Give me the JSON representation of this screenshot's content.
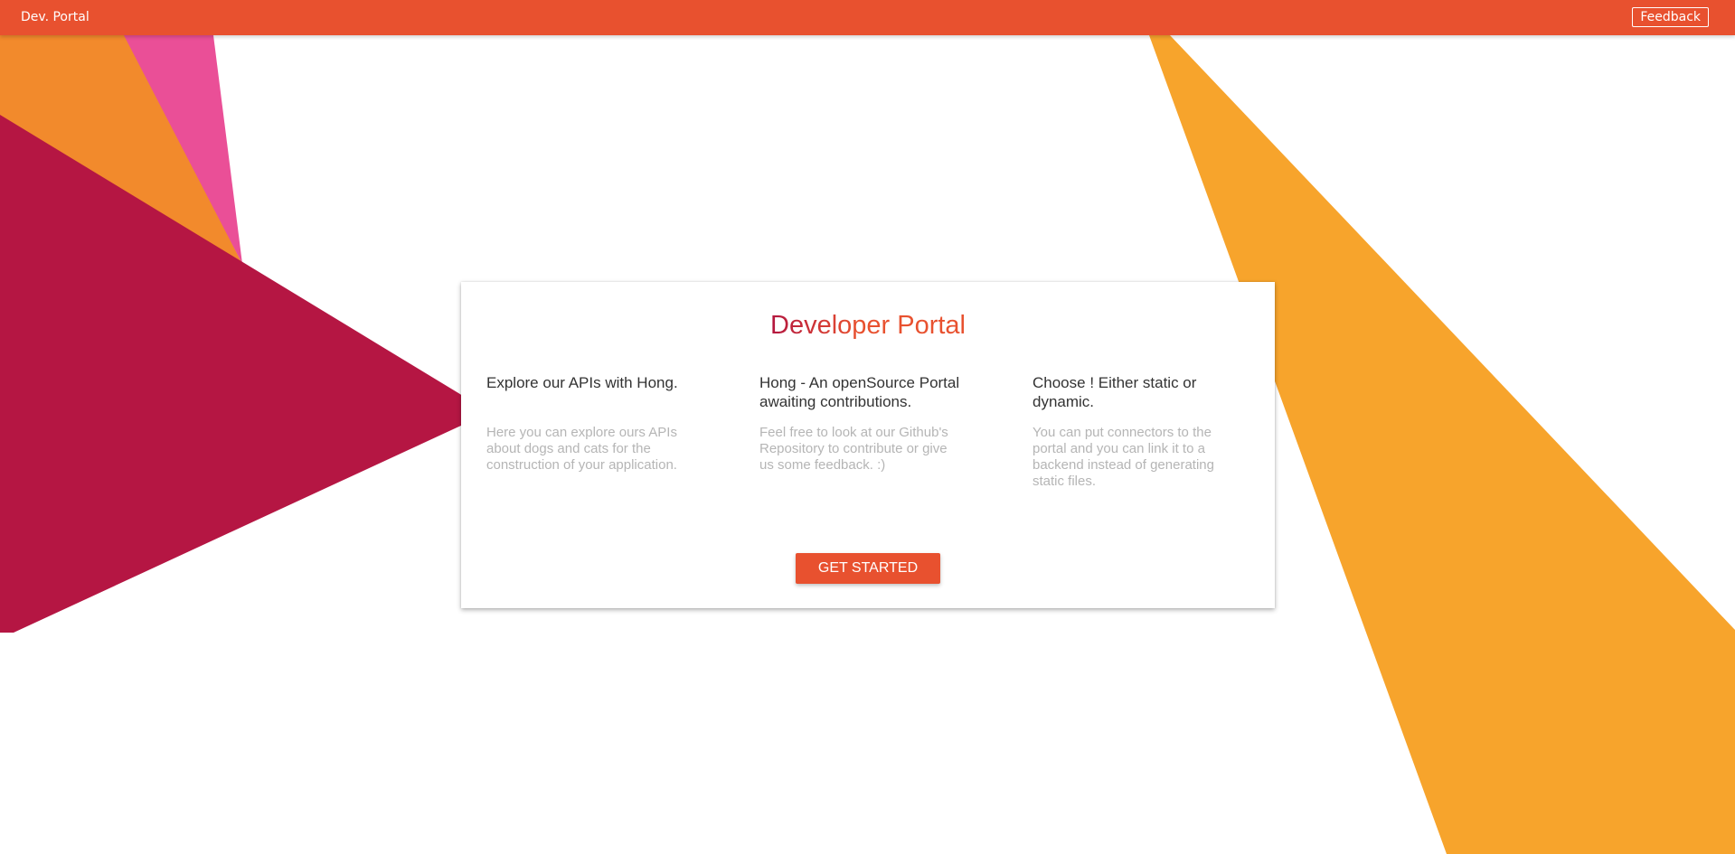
{
  "colors": {
    "topbar": "#e8512f",
    "accent": "#e8512f",
    "title_gradient_start": "#b3163f",
    "title_gradient_end": "#e8512f",
    "shape_orange_left": "#f28a2c",
    "shape_pink": "#ea4f97",
    "shape_crimson": "#b51643",
    "shape_orange_right": "#f7a42c"
  },
  "header": {
    "brand": "Dev. Portal",
    "feedback_label": "Feedback"
  },
  "card": {
    "title": "Developer Portal",
    "columns": [
      {
        "heading": "Explore our APIs with Hong.",
        "text": "Here you can explore ours APIs about dogs and cats for the construction of your application."
      },
      {
        "heading": "Hong - An openSource Portal awaiting contributions.",
        "text": "Feel free to look at our Github's Repository to contribute or give us some feedback. :)"
      },
      {
        "heading": "Choose ! Either static or dynamic.",
        "text": "You can put connectors to the portal and you can link it to a backend instead of generating static files."
      }
    ],
    "cta_label": "GET STARTED"
  }
}
